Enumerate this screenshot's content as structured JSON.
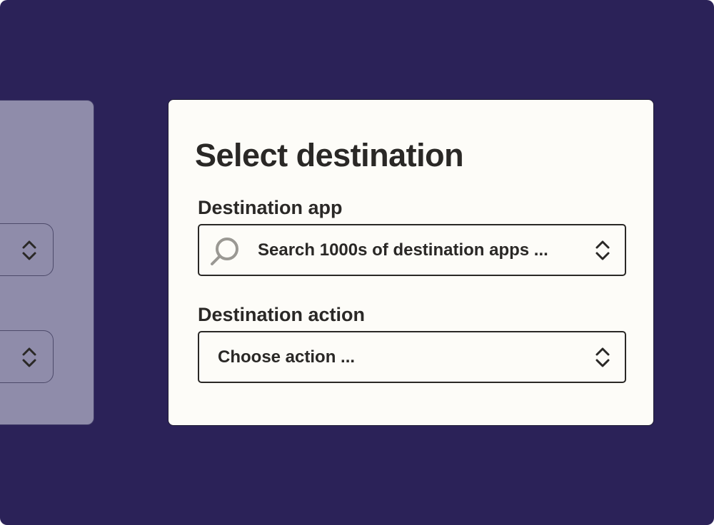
{
  "colors": {
    "background": "#2b2258",
    "card": "#fdfcf8",
    "muted_panel": "#8f8caa",
    "text": "#2a2826"
  },
  "dialog": {
    "title": "Select destination",
    "app_field": {
      "label": "Destination app",
      "placeholder": "Search 1000s of destination apps ...",
      "icon": "search-icon"
    },
    "action_field": {
      "label": "Destination action",
      "placeholder": "Choose action ..."
    }
  }
}
